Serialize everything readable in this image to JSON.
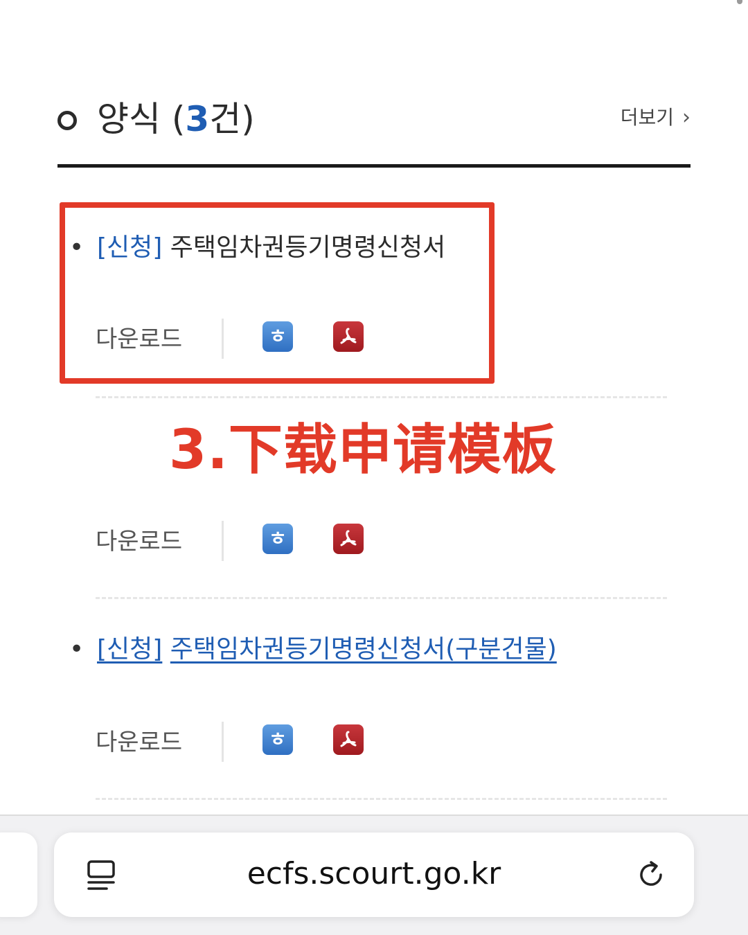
{
  "section": {
    "title_prefix": "양식 (",
    "count": "3",
    "title_suffix": "건)",
    "more_label": "더보기",
    "more_chevron": "›"
  },
  "items": [
    {
      "tag": "[신청]",
      "name": "주택임차권등기명령신청서",
      "download_label": "다운로드",
      "hwp_glyph": "ㅎ",
      "hwp_icon": "hwp-file-icon",
      "pdf_icon": "pdf-file-icon"
    },
    {
      "download_label": "다운로드",
      "hwp_glyph": "ㅎ",
      "hwp_icon": "hwp-file-icon",
      "pdf_icon": "pdf-file-icon"
    },
    {
      "tag": "[신청]",
      "name": "주택임차권등기명령신청서(구분건물)",
      "download_label": "다운로드",
      "hwp_glyph": "ㅎ",
      "hwp_icon": "hwp-file-icon",
      "pdf_icon": "pdf-file-icon"
    }
  ],
  "annotation": {
    "text": "3.下载申请模板",
    "color": "#e23a28"
  },
  "browser": {
    "url": "ecfs.scourt.go.kr",
    "reader_icon": "reader-mode-icon",
    "reload_icon": "reload-icon"
  },
  "colors": {
    "accent_blue": "#1f5db3",
    "annotation_red": "#e23a28",
    "hwp_blue": "#3f83d3",
    "pdf_red": "#b5262b"
  }
}
